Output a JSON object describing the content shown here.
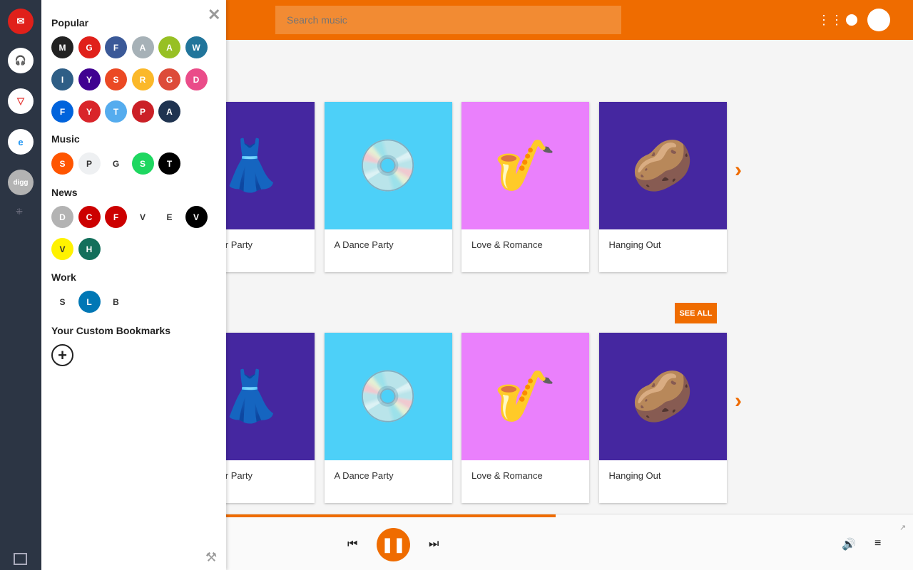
{
  "header": {
    "search_placeholder": "Search music"
  },
  "drawer": {
    "sections": [
      {
        "title": "Popular",
        "items": [
          [
            "myfeed",
            "#222"
          ],
          [
            "gmail",
            "#e0201a"
          ],
          [
            "facebook",
            "#3b5998"
          ],
          [
            "apple",
            "#a6b1b7"
          ],
          [
            "android",
            "#97c024"
          ],
          [
            "wordpress",
            "#21759b"
          ],
          [
            "instagram",
            "#2e5e86"
          ],
          [
            "yahoo",
            "#400191"
          ],
          [
            "stumbleupon",
            "#eb4924"
          ],
          [
            "rss",
            "#fbb829"
          ],
          [
            "google-plus",
            "#dd4b39"
          ],
          [
            "dribbble",
            "#ea4c89"
          ],
          [
            "flickr",
            "#0063dc"
          ],
          [
            "youtube",
            "#d9252a"
          ],
          [
            "twitter",
            "#55acee"
          ],
          [
            "pinterest",
            "#cb2027"
          ],
          [
            "amazon",
            "#1f3350"
          ]
        ]
      },
      {
        "title": "Music",
        "items": [
          [
            "soundcloud",
            "#ff5500"
          ],
          [
            "pandora",
            "#eef0f2"
          ],
          [
            "google-play-music",
            "#fff"
          ],
          [
            "spotify",
            "#1ed760"
          ],
          [
            "tidal",
            "#000"
          ]
        ]
      },
      {
        "title": "News",
        "items": [
          [
            "digg",
            "#b3b3b3"
          ],
          [
            "cnn",
            "#cc0000"
          ],
          [
            "flipboard",
            "#cc0000"
          ],
          [
            "verge",
            "#fff"
          ],
          [
            "engadget",
            "#fff"
          ],
          [
            "vice",
            "#000"
          ],
          [
            "vox",
            "#fff200"
          ],
          [
            "huffpost",
            "#136f5b"
          ]
        ]
      },
      {
        "title": "Work",
        "items": [
          [
            "slack",
            "#fff"
          ],
          [
            "linkedin",
            "#0077b5"
          ],
          [
            "basecamp",
            "#fff"
          ]
        ]
      },
      {
        "title": "Your Custom Bookmarks",
        "items": []
      }
    ]
  },
  "rows": [
    {
      "cards": [
        "on Your Party",
        "A Dance Party",
        "Love & Romance",
        "Hanging Out"
      ]
    },
    {
      "see_all": "SEE ALL",
      "cards": [
        "on Your Party",
        "A Dance Party",
        "Love & Romance",
        "Hanging Out"
      ]
    }
  ],
  "card_colors": [
    "#4527a0",
    "#4dd0f8",
    "#ea80fc",
    "#4527a0"
  ],
  "player": {
    "progress_percent": 59,
    "state": "playing"
  },
  "accent": "#ef6c00"
}
